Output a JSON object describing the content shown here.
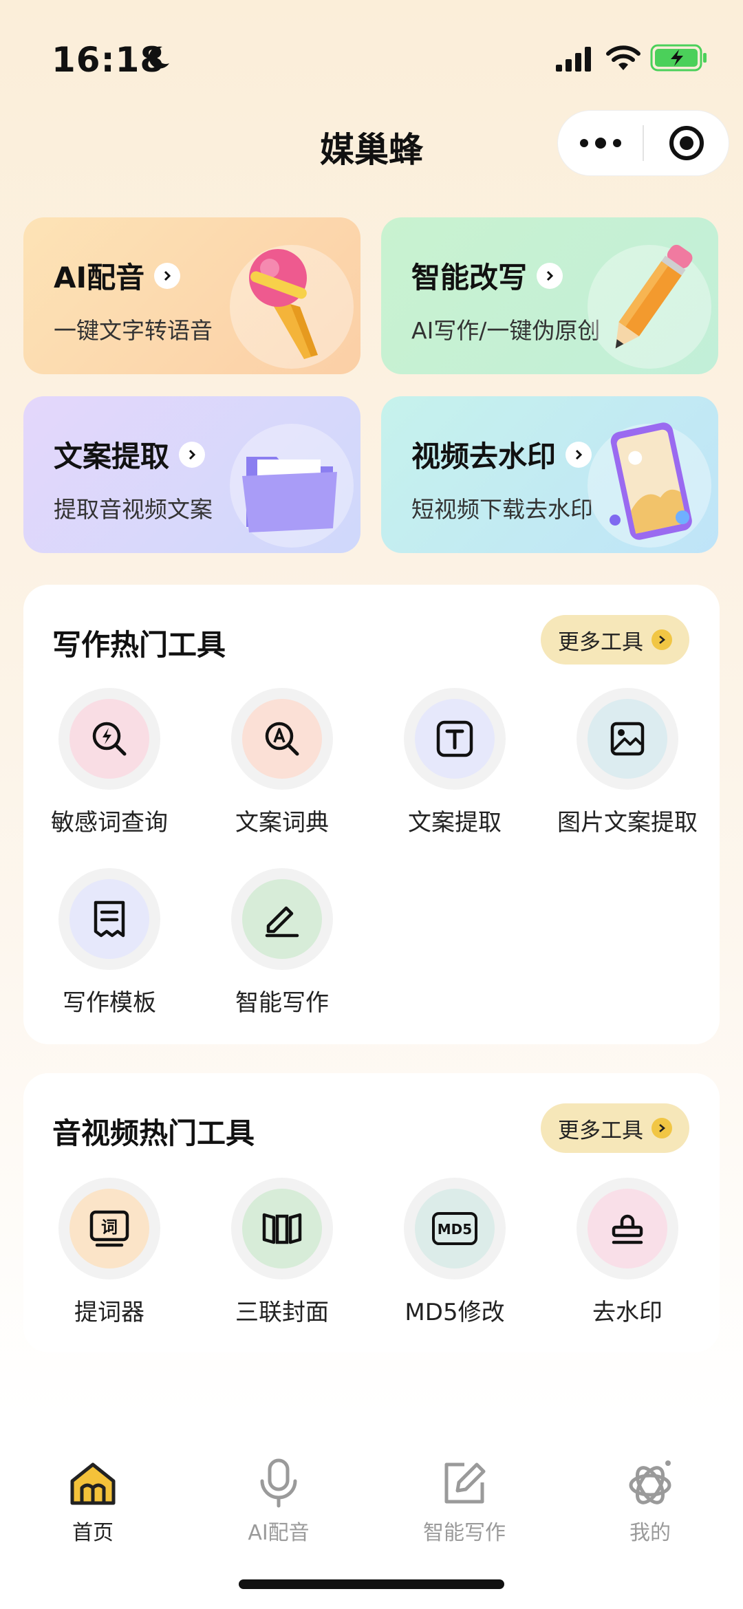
{
  "status_bar": {
    "time": "16:18"
  },
  "nav": {
    "title": "媒巢蜂"
  },
  "features": [
    {
      "title": "AI配音",
      "subtitle": "一键文字转语音",
      "art": "microphone"
    },
    {
      "title": "智能改写",
      "subtitle": "AI写作/一键伪原创",
      "art": "pencil"
    },
    {
      "title": "文案提取",
      "subtitle": "提取音视频文案",
      "art": "folder"
    },
    {
      "title": "视频去水印",
      "subtitle": "短视频下载去水印",
      "art": "phone"
    }
  ],
  "writing_tools": {
    "title": "写作热门工具",
    "more_label": "更多工具",
    "items": [
      {
        "label": "敏感词查询",
        "icon": "sensitive-search-icon"
      },
      {
        "label": "文案词典",
        "icon": "dictionary-search-icon"
      },
      {
        "label": "文案提取",
        "icon": "text-t-icon"
      },
      {
        "label": "图片文案提取",
        "icon": "image-icon"
      },
      {
        "label": "写作模板",
        "icon": "template-icon"
      },
      {
        "label": "智能写作",
        "icon": "edit-icon"
      }
    ]
  },
  "av_tools": {
    "title": "音视频热门工具",
    "more_label": "更多工具",
    "items": [
      {
        "label": "提词器",
        "icon": "teleprompter-icon",
        "glyph": "词"
      },
      {
        "label": "三联封面",
        "icon": "triptych-icon"
      },
      {
        "label": "MD5修改",
        "icon": "md5-icon",
        "glyph": "MD5"
      },
      {
        "label": "去水印",
        "icon": "stamp-icon"
      }
    ]
  },
  "tabbar": {
    "tabs": [
      {
        "label": "首页",
        "icon": "home-icon",
        "active": true
      },
      {
        "label": "AI配音",
        "icon": "microphone-icon",
        "active": false
      },
      {
        "label": "智能写作",
        "icon": "edit-icon",
        "active": false
      },
      {
        "label": "我的",
        "icon": "profile-icon",
        "active": false
      }
    ]
  }
}
